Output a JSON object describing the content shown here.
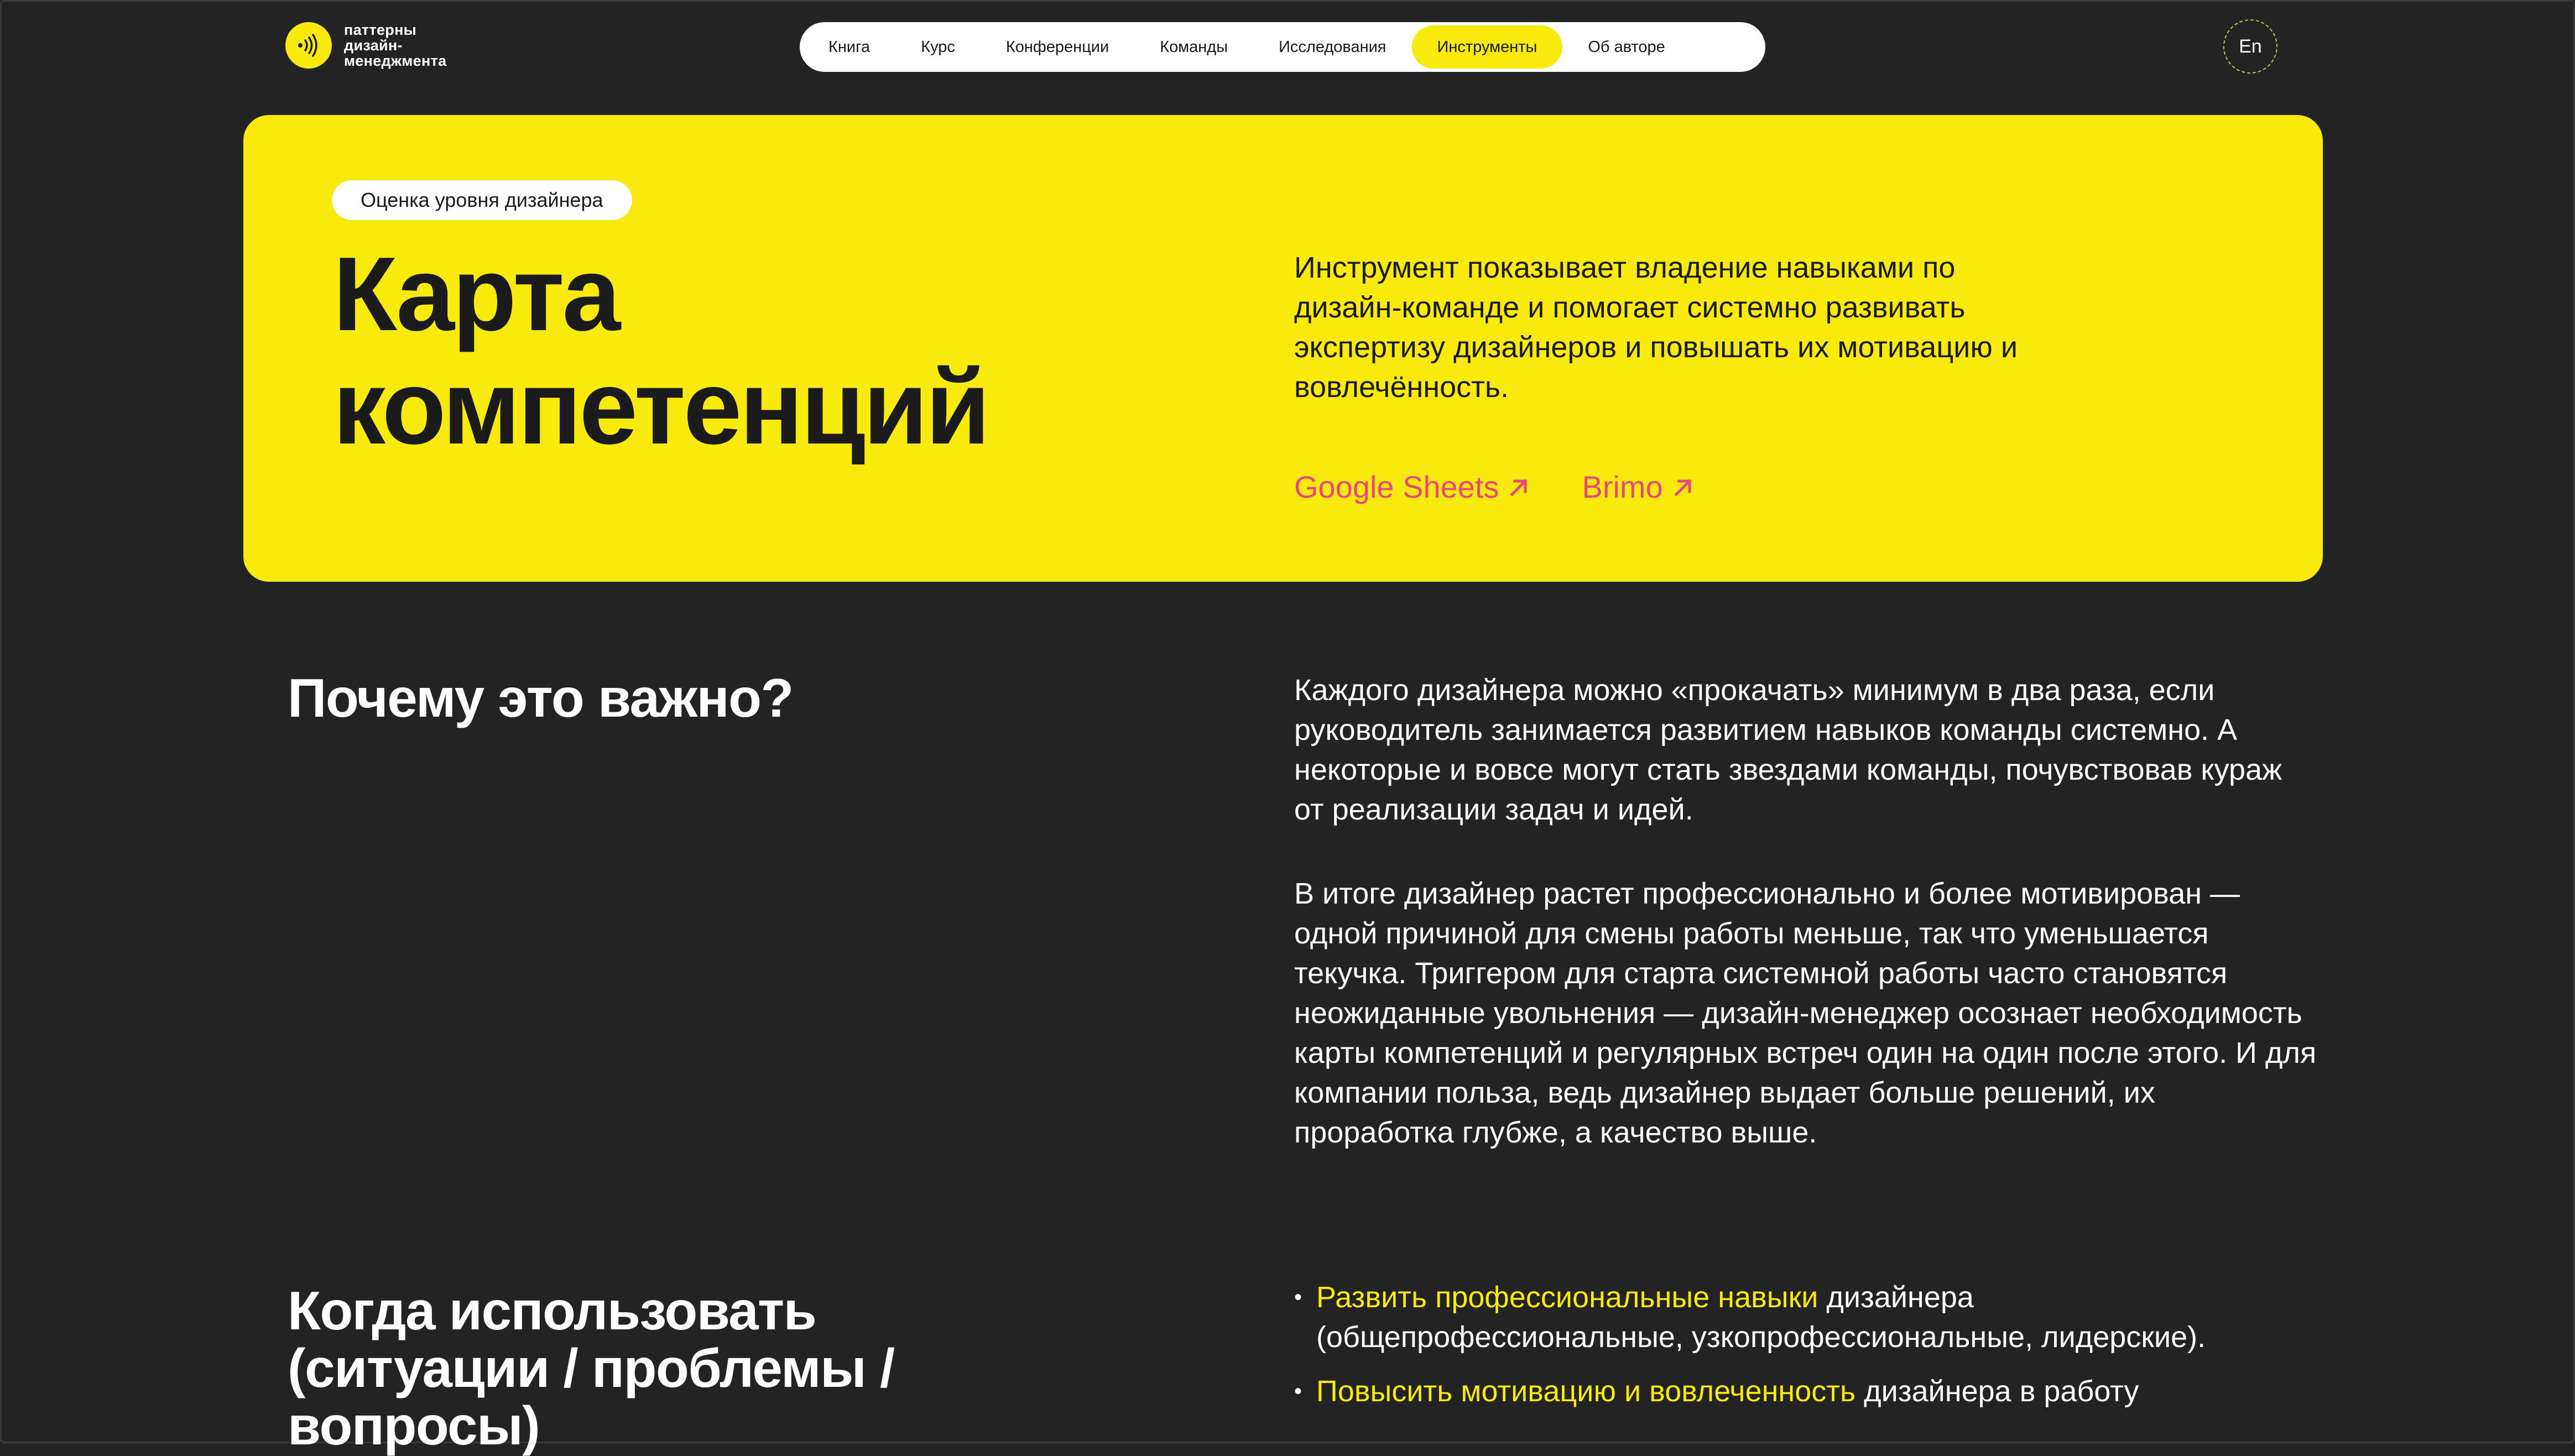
{
  "header": {
    "logo_lines": [
      "паттерны",
      "дизайн-",
      "менеджмента"
    ],
    "nav": [
      {
        "label": "Книга"
      },
      {
        "label": "Курс"
      },
      {
        "label": "Конференции"
      },
      {
        "label": "Команды"
      },
      {
        "label": "Исследования"
      },
      {
        "label": "Инструменты",
        "active": true
      },
      {
        "label": "Об авторе"
      }
    ],
    "lang": "En"
  },
  "hero": {
    "tag": "Оценка уровня дизайнера",
    "title_lines": [
      "Карта",
      "компетенций"
    ],
    "description": "Инструмент показывает владение навыками по дизайн-команде и помогает системно развивать экспертизу дизайнеров и повышать их мотивацию и вовлечённость.",
    "links": [
      {
        "label": "Google Sheets"
      },
      {
        "label": "Brimo"
      }
    ]
  },
  "why": {
    "title": "Почему это важно?",
    "paragraphs": [
      "Каждого дизайнера можно «прокачать» минимум в два раза, если руководитель занимается развитием навыков команды системно. А некоторые и вовсе могут стать звездами команды, почувствовав кураж от реализации задач и идей.",
      "В итоге дизайнер растет профессионально и более мотивирован — одной причиной для смены работы меньше, так что уменьшается текучка. Триггером для старта системной работы часто становятся неожиданные увольнения — дизайн-менеджер осознает необходимость карты компетенций и регулярных встреч один на один после этого. И для компании польза, ведь дизайнер выдает больше решений, их проработка глубже, а качество выше."
    ]
  },
  "when": {
    "title_lines": [
      "Когда использовать",
      "(ситуации / проблемы /",
      "вопросы)"
    ],
    "bullets": [
      {
        "highlight": "Развить профессиональные навыки",
        "rest": " дизайнера (общепрофессиональные, узкопрофессиональные, лидерские)."
      },
      {
        "highlight": "Повысить мотивацию и вовлеченность",
        "rest": " дизайнера в работу"
      }
    ]
  },
  "colors": {
    "background": "#232323",
    "accent_yellow": "#f7ea0c",
    "link_pink": "#e8477a"
  }
}
